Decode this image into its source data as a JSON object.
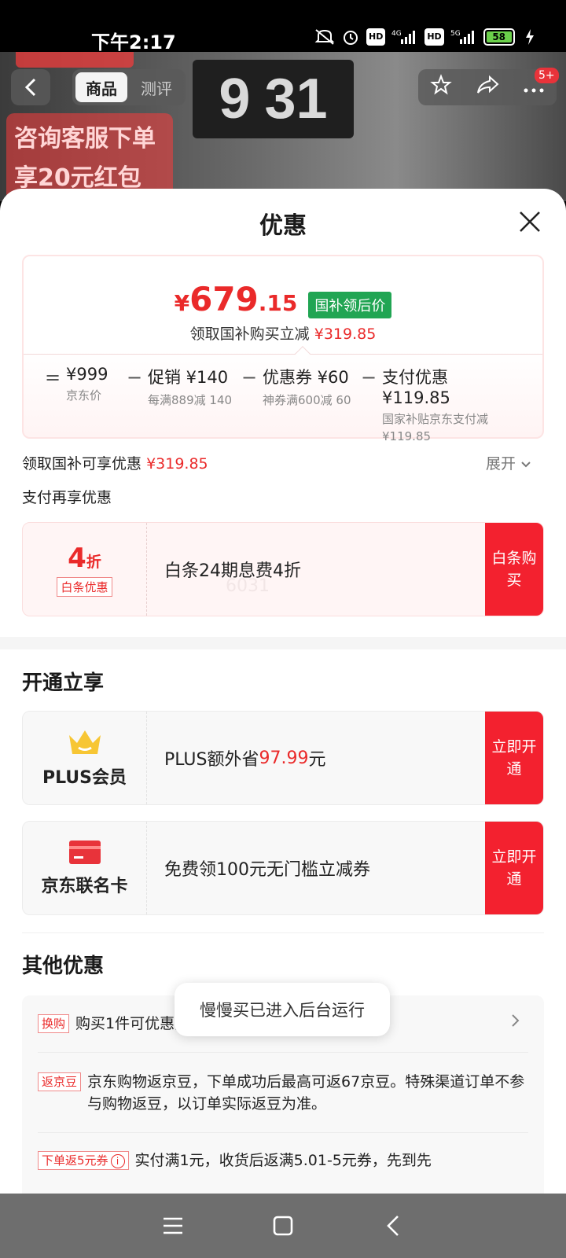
{
  "status_bar": {
    "time": "下午2:17",
    "hd1": "HD",
    "net1": "4G",
    "hd2": "HD",
    "net2": "5G",
    "battery": "58"
  },
  "product_header": {
    "clock_digits": [
      "9",
      "31"
    ],
    "promo_text": [
      "咨询客服下单",
      "享20元红包"
    ],
    "tabs": [
      "商品",
      "测评"
    ],
    "message_count": "5+"
  },
  "sheet": {
    "title": "优惠",
    "price": {
      "currency": "¥",
      "integer": "679",
      "decimal": ".15",
      "tag": "国补领后价"
    },
    "price_sub": {
      "label": "领取国补购买立减",
      "amount": "¥319.85"
    },
    "breakdown": [
      {
        "op": "=",
        "main": "¥999",
        "sub": "京东价"
      },
      {
        "op": "−",
        "main": "促销 ¥140",
        "sub": "每满889减 140"
      },
      {
        "op": "−",
        "main": "优惠券 ¥60",
        "sub": "神券满600减 60"
      },
      {
        "op": "−",
        "main": "支付优惠 ¥119.85",
        "sub": "国家补贴京东支付减 ¥119.85"
      }
    ],
    "subsidy_row": {
      "label": "领取国补可享优惠",
      "amount": "¥319.85",
      "expand": "展开"
    },
    "pay_section_label": "支付再享优惠",
    "baitiao": {
      "discount": "4",
      "discount_unit": "折",
      "tag": "白条优惠",
      "desc": "白条24期息费4折",
      "ghost": "6031",
      "button": "白条购买"
    },
    "open_section_title": "开通立享",
    "plus": {
      "label": "PLUS会员",
      "desc_prefix": "PLUS额外省",
      "desc_amount": "97.99",
      "desc_suffix": "元",
      "button": "立即开通"
    },
    "jdcard": {
      "label": "京东联名卡",
      "desc": "免费领100元无门槛立减券",
      "button": "立即开通"
    },
    "other_section_title": "其他优惠",
    "other": [
      {
        "tag": "换购",
        "text": "购买1件可优惠换购热销商品"
      },
      {
        "tag": "返京豆",
        "text": "京东购物返京豆，下单成功后最高可返67京豆。特殊渠道订单不参与购物返豆，以订单实际返豆为准。"
      },
      {
        "tag": "下单返5元券",
        "text": "实付满1元，收货后返满5.01-5元券，先到先"
      }
    ],
    "toast": "慢慢买已进入后台运行"
  },
  "colors": {
    "accent_red": "#ea2a2a",
    "button_red": "#f3212f",
    "gov_green": "#21a553"
  }
}
